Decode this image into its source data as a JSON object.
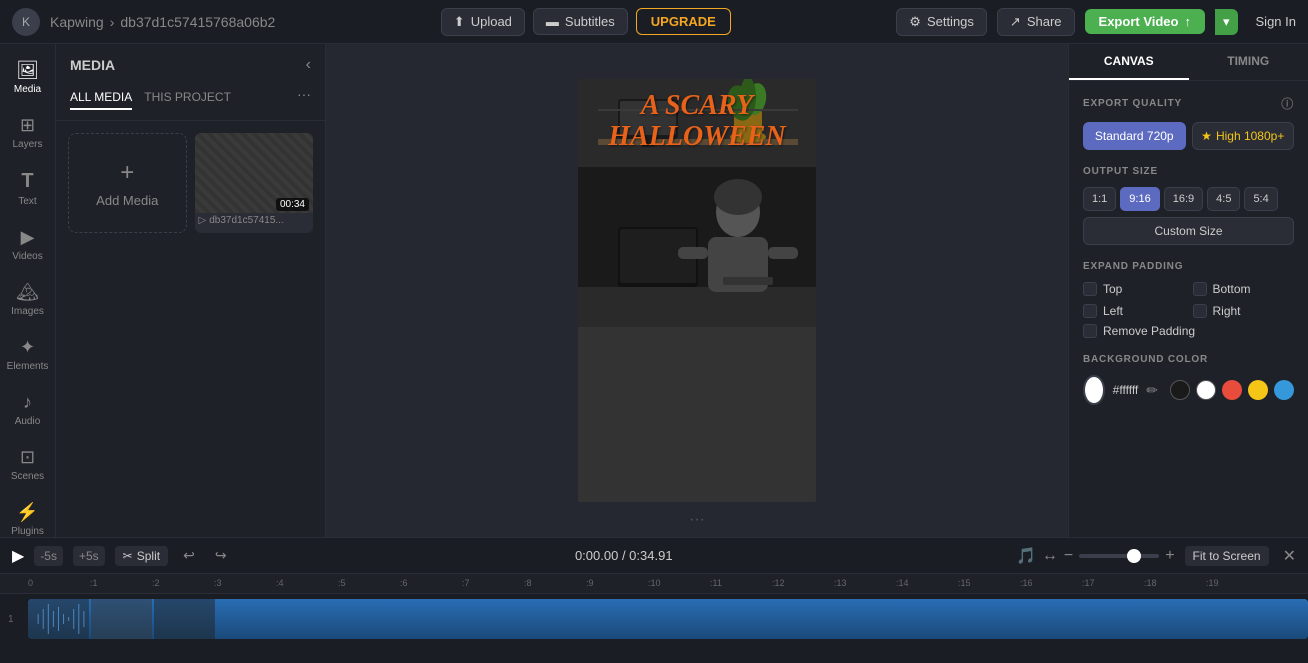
{
  "app": {
    "logo_text": "K",
    "brand_name": "Kapwing",
    "project_name": "db37d1c57415768a06b2"
  },
  "topbar": {
    "upload_label": "Upload",
    "subtitles_label": "Subtitles",
    "upgrade_label": "UPGRADE",
    "settings_label": "Settings",
    "share_label": "Share",
    "export_label": "Export Video",
    "signin_label": "Sign In"
  },
  "sidebar": {
    "items": [
      {
        "id": "media",
        "label": "Media",
        "icon": "🖼"
      },
      {
        "id": "layers",
        "label": "Layers",
        "icon": "⊞"
      },
      {
        "id": "text",
        "label": "Text",
        "icon": "T"
      },
      {
        "id": "videos",
        "label": "Videos",
        "icon": "▶"
      },
      {
        "id": "images",
        "label": "Images",
        "icon": "🏔"
      },
      {
        "id": "elements",
        "label": "Elements",
        "icon": "✦"
      },
      {
        "id": "audio",
        "label": "Audio",
        "icon": "♪"
      },
      {
        "id": "scenes",
        "label": "Scenes",
        "icon": "⊡"
      },
      {
        "id": "plugins",
        "label": "Plugins",
        "icon": "⚡"
      }
    ]
  },
  "media_panel": {
    "title": "MEDIA",
    "tabs": [
      {
        "id": "all",
        "label": "ALL MEDIA",
        "active": true
      },
      {
        "id": "project",
        "label": "THIS PROJECT",
        "active": false
      }
    ],
    "add_media_label": "Add Media",
    "media_items": [
      {
        "duration": "00:34",
        "name": "db37d1c57415..."
      }
    ]
  },
  "canvas_overlay": {
    "title_line1": "A SCARY",
    "title_line2": "HALLOWEEN"
  },
  "right_panel": {
    "tabs": [
      {
        "id": "canvas",
        "label": "CANVAS",
        "active": true
      },
      {
        "id": "timing",
        "label": "TIMING",
        "active": false
      }
    ],
    "export_quality": {
      "title": "EXPORT QUALITY",
      "options": [
        {
          "id": "720p",
          "label": "Standard 720p",
          "active": true
        },
        {
          "id": "1080p",
          "label": "★ High 1080p+",
          "active": false,
          "premium": true
        }
      ]
    },
    "output_size": {
      "title": "OUTPUT SIZE",
      "options": [
        {
          "id": "1:1",
          "label": "1:1",
          "active": false
        },
        {
          "id": "9:16",
          "label": "9:16",
          "active": true
        },
        {
          "id": "16:9",
          "label": "16:9",
          "active": false
        },
        {
          "id": "4:5",
          "label": "4:5",
          "active": false
        },
        {
          "id": "5:4",
          "label": "5:4",
          "active": false
        }
      ],
      "custom_label": "Custom Size"
    },
    "expand_padding": {
      "title": "EXPAND PADDING",
      "items": [
        {
          "id": "top",
          "label": "Top",
          "checked": false
        },
        {
          "id": "bottom",
          "label": "Bottom",
          "checked": false
        },
        {
          "id": "left",
          "label": "Left",
          "checked": false
        },
        {
          "id": "right",
          "label": "Right",
          "checked": false
        }
      ],
      "remove_label": "Remove Padding"
    },
    "background_color": {
      "title": "BACKGROUND COLOR",
      "hex": "#ffffff",
      "swatches": [
        "#1a1a1a",
        "#fff",
        "#e74c3c",
        "#f5c518",
        "#2ecc71",
        "#3498db"
      ]
    }
  },
  "bottom_bar": {
    "time_skip_back": "-5s",
    "time_skip_fwd": "+5s",
    "split_label": "Split",
    "current_time": "0:00.00",
    "total_time": "0:34.91",
    "time_separator": "/",
    "fit_screen_label": "Fit to Screen"
  },
  "timeline": {
    "row_label": "1",
    "ticks": [
      "0",
      ":1",
      ":2",
      ":3",
      ":4",
      ":5",
      ":6",
      ":7",
      ":8",
      ":9",
      ":10",
      ":11",
      ":12",
      ":13",
      ":14",
      ":15",
      ":16",
      ":17",
      ":18",
      ":19"
    ]
  }
}
